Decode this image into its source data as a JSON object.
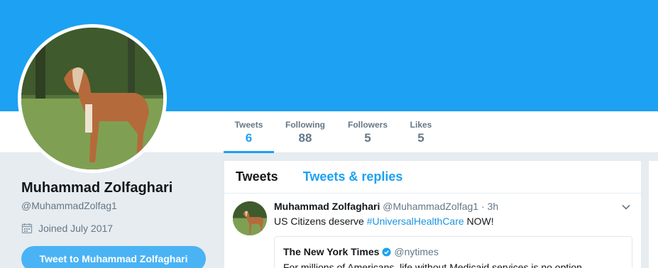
{
  "profile": {
    "name": "Muhammad Zolfaghari",
    "handle": "@MuhammadZolfag1",
    "joined": "Joined July 2017",
    "tweet_to_button": "Tweet to Muhammad Zolfaghari"
  },
  "nav": {
    "stats": [
      {
        "label": "Tweets",
        "value": "6"
      },
      {
        "label": "Following",
        "value": "88"
      },
      {
        "label": "Followers",
        "value": "5"
      },
      {
        "label": "Likes",
        "value": "5"
      }
    ]
  },
  "timeline": {
    "tabs": [
      {
        "label": "Tweets"
      },
      {
        "label": "Tweets & replies"
      }
    ],
    "tweet": {
      "author_name": "Muhammad Zolfaghari",
      "author_handle": "@MuhammadZolfag1",
      "separator": " · ",
      "time": "3h",
      "text_before": "US Citizens deserve ",
      "hashtag": "#UniversalHealthCare",
      "text_after": " NOW!",
      "quote": {
        "name": "The New York Times",
        "handle": "@nytimes",
        "text": "For millions of Americans, life without Medicaid services is no option"
      }
    }
  },
  "colors": {
    "accent": "#1da1f2",
    "banner": "#1da1f2",
    "background": "#e6ecf0",
    "muted_text": "#657786",
    "tweet_button": "#4ab3f4"
  },
  "icons": [
    "calendar-icon",
    "caret-down-icon",
    "verified-badge-icon"
  ]
}
